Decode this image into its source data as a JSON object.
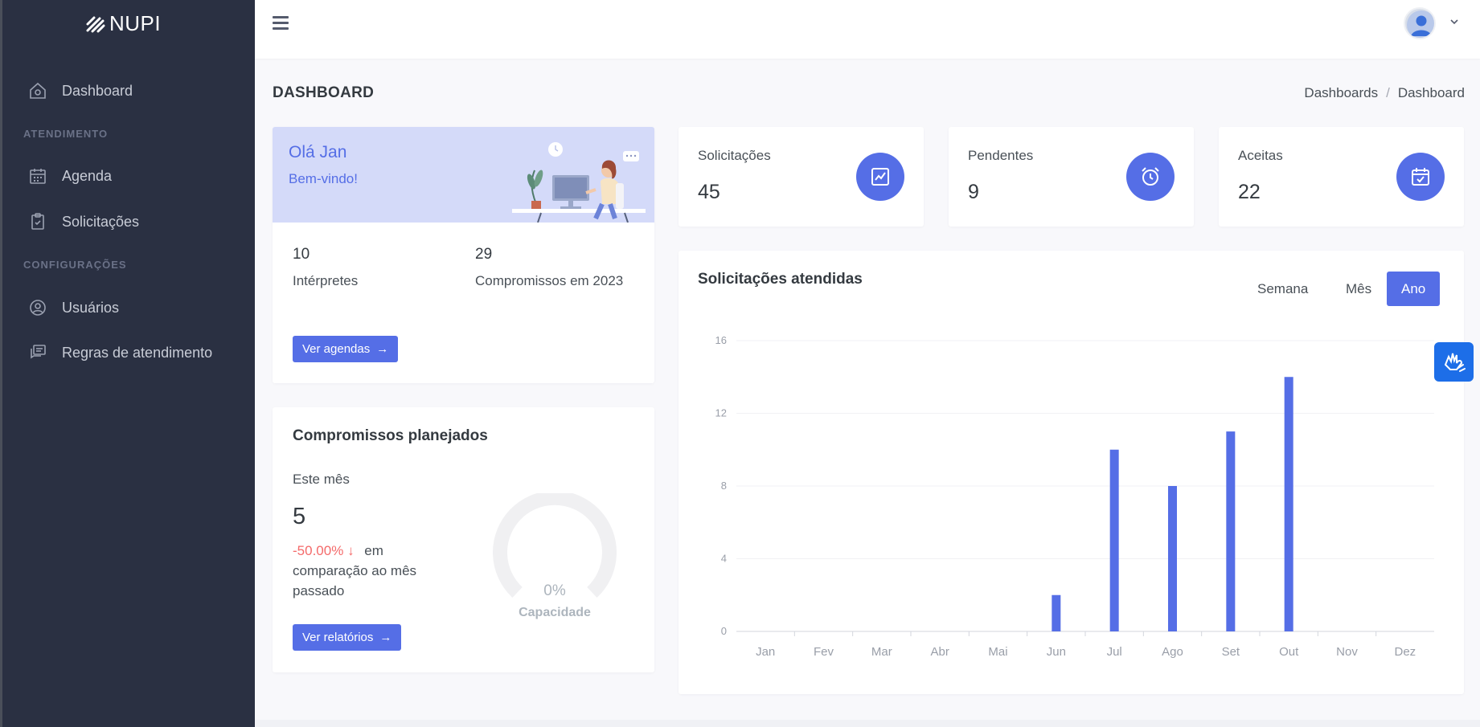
{
  "brand": {
    "name": "NUPI"
  },
  "sidebar": {
    "items": [
      {
        "label": "Dashboard",
        "icon": "home-icon"
      },
      {
        "section": "ATENDIMENTO"
      },
      {
        "label": "Agenda",
        "icon": "calendar-icon"
      },
      {
        "label": "Solicitações",
        "icon": "clipboard-check-icon"
      },
      {
        "section": "CONFIGURAÇÕES"
      },
      {
        "label": "Usuários",
        "icon": "user-circle-icon"
      },
      {
        "label": "Regras de atendimento",
        "icon": "chat-icon"
      }
    ]
  },
  "page": {
    "title": "DASHBOARD",
    "breadcrumb": [
      "Dashboards",
      "Dashboard"
    ]
  },
  "welcome": {
    "greeting": "Olá Jan",
    "subtitle": "Bem-vindo!",
    "stats": [
      {
        "value": "10",
        "label": "Intérpretes"
      },
      {
        "value": "29",
        "label": "Compromissos em 2023"
      }
    ],
    "button": "Ver agendas"
  },
  "stat_cards": [
    {
      "label": "Solicitações",
      "value": "45",
      "icon": "chart-line-icon"
    },
    {
      "label": "Pendentes",
      "value": "9",
      "icon": "alarm-clock-icon"
    },
    {
      "label": "Aceitas",
      "value": "22",
      "icon": "calendar-check-icon"
    }
  ],
  "planned": {
    "title": "Compromissos planejados",
    "period": "Este mês",
    "value": "5",
    "change": "-50.00%",
    "change_text": "em comparação ao mês passado",
    "gauge_value": "0%",
    "gauge_label": "Capacidade",
    "gauge_fraction": 0,
    "button": "Ver relatórios"
  },
  "chart": {
    "title": "Solicitações atendidas",
    "tabs": [
      "Semana",
      "Mês",
      "Ano"
    ],
    "active_tab": "Ano"
  },
  "chart_data": {
    "type": "bar",
    "categories": [
      "Jan",
      "Fev",
      "Mar",
      "Abr",
      "Mai",
      "Jun",
      "Jul",
      "Ago",
      "Set",
      "Out",
      "Nov",
      "Dez"
    ],
    "values": [
      0,
      0,
      0,
      0,
      0,
      2,
      10,
      8,
      11,
      14,
      0,
      0
    ],
    "yticks": [
      0,
      4,
      8,
      12,
      16
    ],
    "ylim": [
      0,
      16
    ],
    "color": "#556ee6",
    "grid": true
  },
  "colors": {
    "sidebar": "#2a3042",
    "primary": "#556ee6",
    "danger": "#f46a6a",
    "accessibility": "#1d6ee8"
  }
}
